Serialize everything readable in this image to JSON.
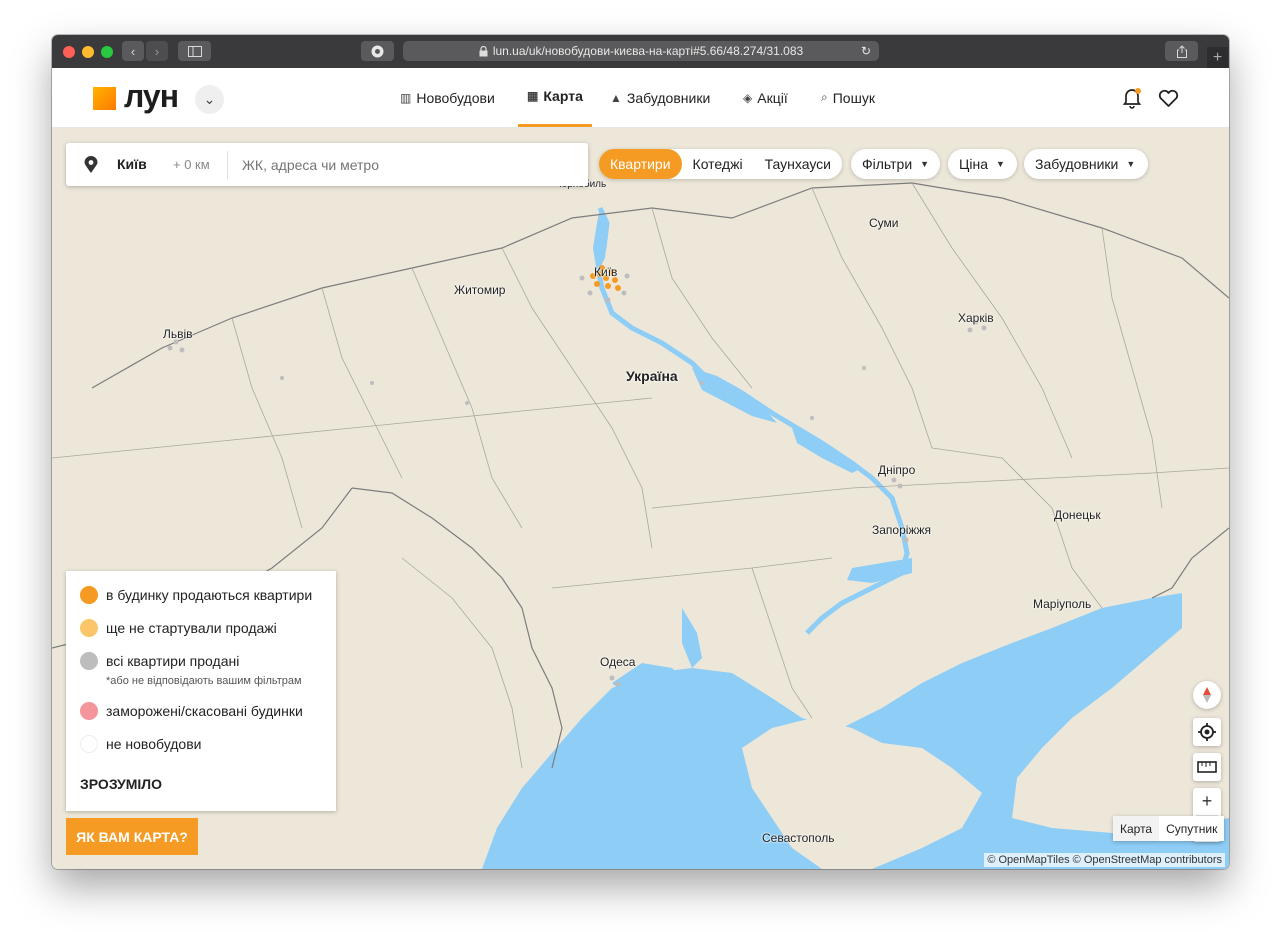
{
  "browser": {
    "url": "lun.ua/uk/новобудови-києва-на-карті#5.66/48.274/31.083",
    "colors": {
      "close": "#fe5f57",
      "minimize": "#febc2e",
      "maximize": "#28c840"
    }
  },
  "header": {
    "logo_text": "лун",
    "nav": [
      {
        "label": "Новобудови",
        "icon": "building-icon"
      },
      {
        "label": "Карта",
        "icon": "map-icon"
      },
      {
        "label": "Забудовники",
        "icon": "crane-icon"
      },
      {
        "label": "Акції",
        "icon": "tag-icon"
      },
      {
        "label": "Пошук",
        "icon": "search-icon"
      }
    ]
  },
  "search": {
    "city": "Київ",
    "radius": "+ 0 км",
    "placeholder": "ЖК, адреса чи метро"
  },
  "filters": {
    "types": [
      "Квартири",
      "Котеджі",
      "Таунхауси"
    ],
    "active_type": "Квартири",
    "dropdowns": [
      "Фільтри",
      "Ціна",
      "Забудовники"
    ]
  },
  "map": {
    "cities": [
      "Чорнобиль",
      "Київ",
      "Житомир",
      "Суми",
      "Львів",
      "Україна",
      "Харків",
      "Дніпро",
      "Донецьк",
      "Запоріжжя",
      "Маріуполь",
      "Одеса",
      "Севастополь"
    ],
    "colors": {
      "land": "#ece7d9",
      "water": "#8dcdf6",
      "accent": "#f59a23"
    }
  },
  "legend": {
    "items": [
      {
        "label": "в будинку продаються квартири",
        "color": "#f59a23"
      },
      {
        "label": "ще не стартували продажі",
        "color": "#fbc56a"
      },
      {
        "label": "всі квартири продані",
        "color": "#bdbdbd",
        "note": "*або не відповідають вашим фільтрам"
      },
      {
        "label": "заморожені/скасовані будинки",
        "color": "#f3959a"
      },
      {
        "label": "не новобудови",
        "color": "#ffffff"
      }
    ],
    "confirm": "ЗРОЗУМІЛО"
  },
  "feedback": "ЯК ВАМ КАРТА?",
  "map_type": [
    "Карта",
    "Супутник"
  ],
  "attribution": "© OpenMapTiles © OpenStreetMap contributors"
}
